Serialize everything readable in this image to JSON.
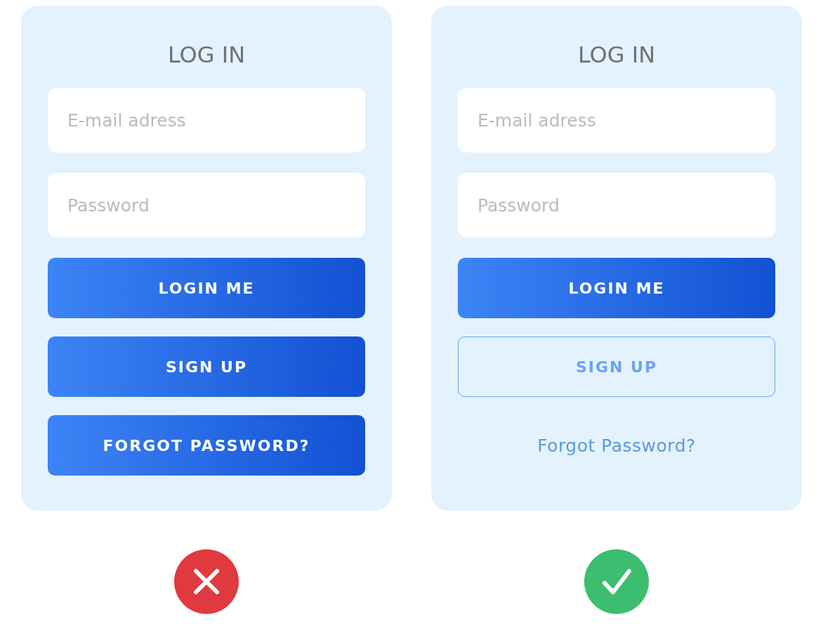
{
  "panels": [
    {
      "title": "LOG IN",
      "fields": [
        {
          "placeholder": "E-mail adress"
        },
        {
          "placeholder": "Password"
        }
      ],
      "actions": [
        {
          "kind": "primary",
          "label": "LOGIN ME"
        },
        {
          "kind": "primary",
          "label": "SIGN UP"
        },
        {
          "kind": "primary",
          "label": "FORGOT PASSWORD?"
        }
      ],
      "verdict": {
        "kind": "wrong"
      }
    },
    {
      "title": "LOG IN",
      "fields": [
        {
          "placeholder": "E-mail adress"
        },
        {
          "placeholder": "Password"
        }
      ],
      "actions": [
        {
          "kind": "primary",
          "label": "LOGIN ME"
        },
        {
          "kind": "outline",
          "label": "SIGN UP"
        },
        {
          "kind": "link",
          "label": "Forgot Password?"
        }
      ],
      "verdict": {
        "kind": "right"
      }
    }
  ]
}
